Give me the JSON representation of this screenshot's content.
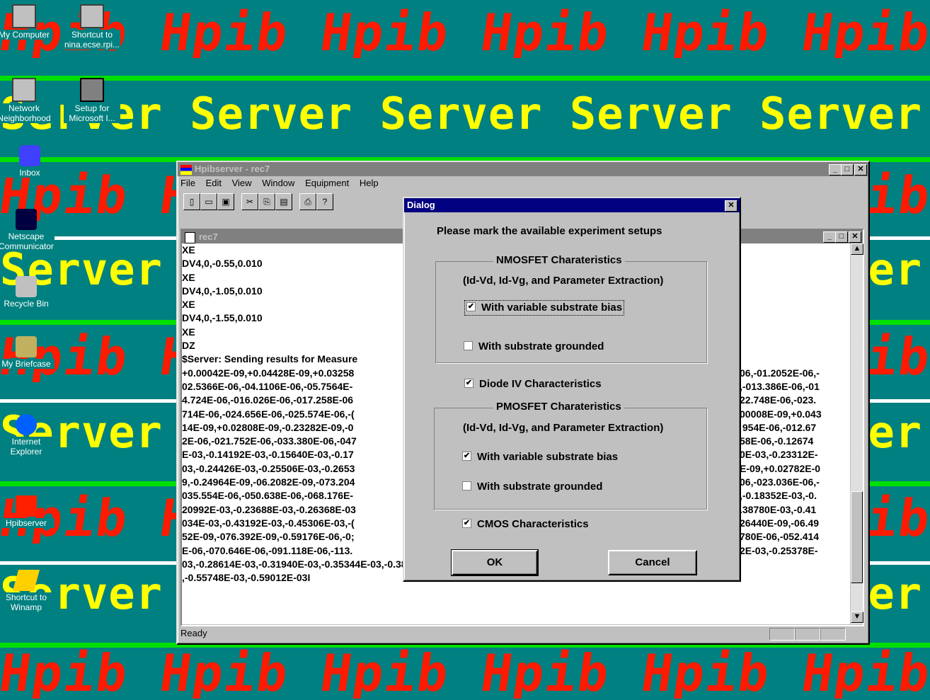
{
  "wallpaper": {
    "red_word": "Hpib",
    "yellow_word": "Server"
  },
  "desktop_icons": [
    {
      "label_lines": [
        "My Computer"
      ],
      "icon": "computer-icon"
    },
    {
      "label_lines": [
        "Shortcut to",
        "nina.ecse.rpi..."
      ],
      "icon": "shortcut-computer-icon"
    },
    {
      "label_lines": [
        "Network",
        "Neighborhood"
      ],
      "icon": "network-icon"
    },
    {
      "label_lines": [
        "Setup for",
        "Microsoft I..."
      ],
      "icon": "setup-icon"
    },
    {
      "label_lines": [
        "Inbox"
      ],
      "icon": "inbox-icon"
    },
    {
      "label_lines": [
        "Netscape",
        "Communicator"
      ],
      "icon": "netscape-icon"
    },
    {
      "label_lines": [
        "Recycle Bin"
      ],
      "icon": "recycle-bin-icon"
    },
    {
      "label_lines": [
        "My Briefcase"
      ],
      "icon": "briefcase-icon"
    },
    {
      "label_lines": [
        "Internet",
        "Explorer"
      ],
      "icon": "internet-explorer-icon"
    },
    {
      "label_lines": [
        "Hpibserver"
      ],
      "icon": "hpibserver-icon"
    },
    {
      "label_lines": [
        "Shortcut to",
        "Winamp"
      ],
      "icon": "winamp-icon"
    }
  ],
  "app": {
    "title": "Hpibserver - rec7",
    "menu": [
      "File",
      "Edit",
      "View",
      "Window",
      "Equipment",
      "Help"
    ],
    "toolbar_icons": [
      "new-icon",
      "open-icon",
      "save-icon",
      "cut-icon",
      "copy-icon",
      "paste-icon",
      "print-icon",
      "help-icon"
    ],
    "status": "Ready",
    "child": {
      "title": "rec7",
      "lines": [
        "XE",
        "DV4,0,-0.55,0.010",
        "XE",
        "DV4,0,-1.05,0.010",
        "XE",
        "DV4,0,-1.55,0.010",
        "XE",
        "DZ",
        "$Server: Sending results for Measure",
        "+0.00042E-09,+0.04428E-09,+0.03258",
        "02.5366E-06,-04.1106E-06,-05.7564E-",
        "4.724E-06,-016.026E-06,-017.258E-06",
        "714E-06,-024.656E-06,-025.574E-06,-(",
        "14E-09,+0.02808E-09,-0.23282E-09,-0",
        "2E-06,-021.752E-06,-033.380E-06,-047",
        "E-03,-0.14192E-03,-0.15640E-03,-0.17",
        "03,-0.24426E-03,-0.25506E-03,-0.2653",
        "9,-0.24964E-09,-06.2082E-09,-073.204",
        "035.554E-06,-050.638E-06,-068.176E-",
        "20992E-03,-0.23688E-03,-0.26368E-03",
        "034E-03,-0.43192E-03,-0.45306E-03,-(",
        "52E-09,-076.392E-09,-0.59176E-06,-0;",
        "E-06,-070.646E-06,-091.118E-06,-113.",
        "03,-0.28614E-03,-0.31940E-03,-0.35344E-03,-0.38732E-03,-0.42256E-03,-0.45716E-03,-0.49128E-03,-0.52454E-03",
        ",-0.55748E-03,-0.59012E-03I"
      ],
      "right_lines": [
        "",
        "",
        "",
        "",
        "",
        "",
        "",
        "",
        "",
        "06,-01.2052E-06,-",
        ",-013.386E-06,-01",
        "22.748E-06,-023.",
        "00008E-09,+0.043",
        " 954E-06,-012.67",
        "58E-06,-0.12674",
        "0E-03,-0.23312E-",
        "E-09,+0.02782E-0",
        "06,-023.036E-06,-",
        ",-0.18352E-03,-0.",
        ".38780E-03,-0.41",
        "26440E-09,-06.49",
        "780E-06,-052.414",
        "2E-03,-0.25378E-",
        "",
        ""
      ]
    }
  },
  "dialog": {
    "title": "Dialog",
    "prompt": "Please mark the available experiment setups",
    "nmos_group": "NMOSFET Charateristics",
    "nmos_sub": "(Id-Vd, Id-Vg, and Parameter Extraction)",
    "nmos_var": {
      "label": "With variable substrate bias",
      "checked": true
    },
    "nmos_gnd": {
      "label": "With substrate grounded",
      "checked": false
    },
    "diode": {
      "label": "Diode IV Characteristics",
      "checked": true
    },
    "pmos_group": "PMOSFET Charateristics",
    "pmos_sub": "(Id-Vd, Id-Vg, and Parameter Extraction)",
    "pmos_var": {
      "label": "With variable substrate bias",
      "checked": true
    },
    "pmos_gnd": {
      "label": "With substrate grounded",
      "checked": false
    },
    "cmos": {
      "label": "CMOS Characteristics",
      "checked": true
    },
    "ok": "OK",
    "cancel": "Cancel"
  }
}
